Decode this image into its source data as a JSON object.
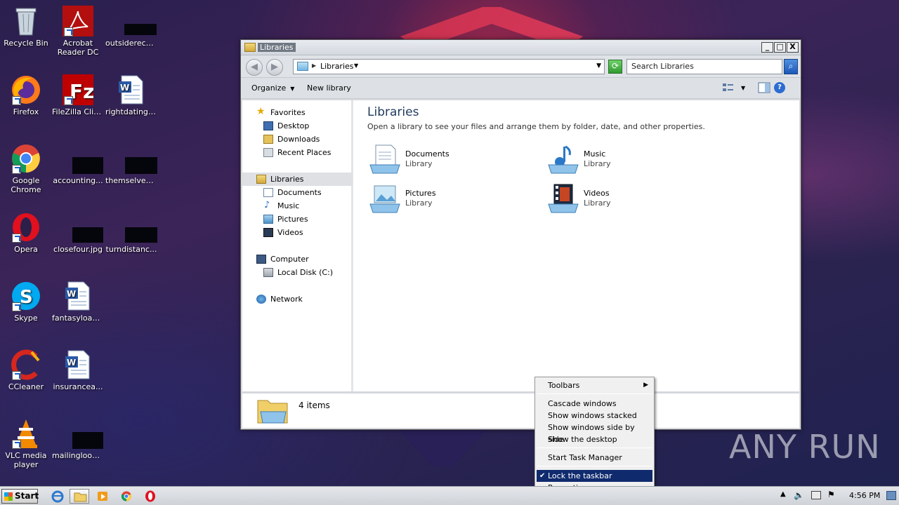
{
  "desktop": {
    "icons": [
      {
        "label": "Recycle Bin"
      },
      {
        "label": "Acrobat Reader DC"
      },
      {
        "label": "outsidereco..."
      },
      {
        "label": "Firefox"
      },
      {
        "label": "FileZilla Client"
      },
      {
        "label": "rightdating.rtf"
      },
      {
        "label": "Google Chrome"
      },
      {
        "label": "accounting..."
      },
      {
        "label": "themselvesi..."
      },
      {
        "label": "Opera"
      },
      {
        "label": "closefour.jpg"
      },
      {
        "label": "turndistanc..."
      },
      {
        "label": "Skype"
      },
      {
        "label": "fantasyloan..."
      },
      {
        "label": "CCleaner"
      },
      {
        "label": "insurancea..."
      },
      {
        "label": "VLC media player"
      },
      {
        "label": "mailinglooks..."
      }
    ]
  },
  "window": {
    "title": "Libraries",
    "buttons": {
      "minimize": "_",
      "maximize": "□",
      "close": "X"
    },
    "address": {
      "crumb": "Libraries"
    },
    "search": {
      "placeholder": "Search Libraries"
    },
    "toolbar": {
      "organize": "Organize",
      "new_library": "New library"
    },
    "nav": {
      "favorites": "Favorites",
      "desktop": "Desktop",
      "downloads": "Downloads",
      "recent_places": "Recent Places",
      "libraries": "Libraries",
      "documents": "Documents",
      "music": "Music",
      "pictures": "Pictures",
      "videos": "Videos",
      "computer": "Computer",
      "local_disk": "Local Disk (C:)",
      "network": "Network"
    },
    "main": {
      "title": "Libraries",
      "subtitle": "Open a library to see your files and arrange them by folder, date, and other properties.",
      "libraries": [
        {
          "name": "Documents",
          "type": "Library"
        },
        {
          "name": "Music",
          "type": "Library"
        },
        {
          "name": "Pictures",
          "type": "Library"
        },
        {
          "name": "Videos",
          "type": "Library"
        }
      ]
    },
    "details": {
      "count": "4 items"
    }
  },
  "context_menu": {
    "toolbars": "Toolbars",
    "cascade": "Cascade windows",
    "stacked": "Show windows stacked",
    "side_by_side": "Show windows side by side",
    "show_desktop": "Show the desktop",
    "task_manager": "Start Task Manager",
    "lock_taskbar": "Lock the taskbar",
    "properties": "Properties"
  },
  "taskbar": {
    "start": "Start",
    "clock": "4:56 PM"
  },
  "watermark": "ANY  RUN"
}
